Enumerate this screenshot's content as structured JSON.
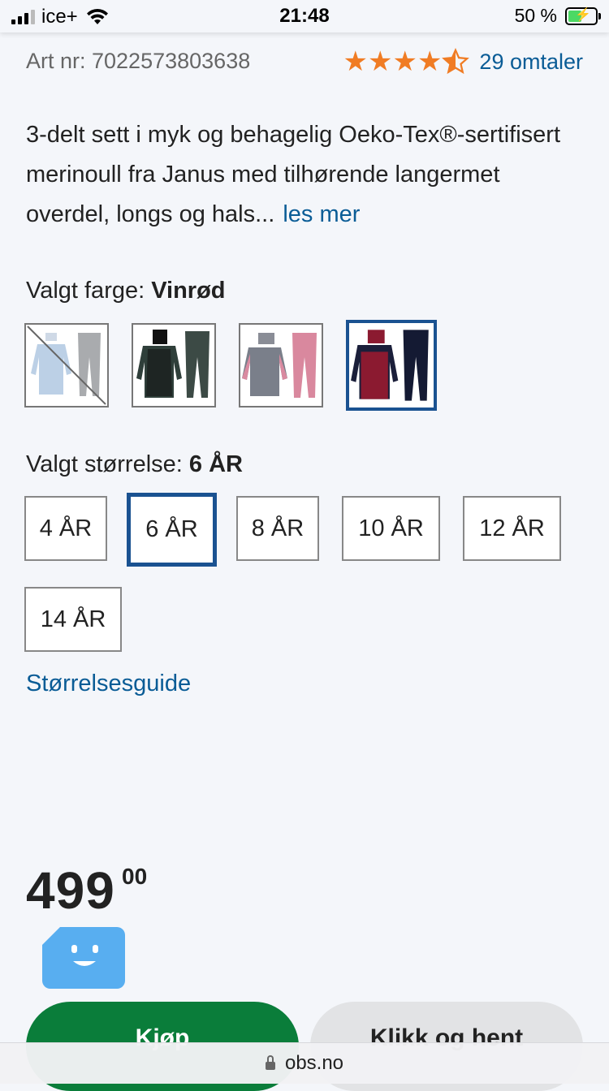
{
  "status_bar": {
    "carrier": "ice+",
    "time": "21:48",
    "battery": "50 %"
  },
  "product": {
    "art_nr": "Art nr: 7022573803638",
    "rating_value": 4.5,
    "reviews": "29 omtaler",
    "description": "3-delt sett i myk og behagelig Oeko-Tex®-sertifisert merinoull fra Janus med tilhørende langermet overdel, longs og hals...",
    "read_more": "les mer",
    "color_label": "Valgt farge: ",
    "color_value": "Vinrød",
    "size_label": "Valgt størrelse: ",
    "size_value": "6 ÅR",
    "sizes": [
      "4 ÅR",
      "6 ÅR",
      "8 ÅR",
      "10 ÅR",
      "12 ÅR",
      "14 ÅR"
    ],
    "size_guide": "Størrelsesguide",
    "price_main": "499",
    "price_decimals": "00"
  },
  "actions": {
    "buy": "Kjøp",
    "click_collect": "Klikk og hent"
  },
  "browser": {
    "url": "obs.no"
  },
  "colors": {
    "accent_blue": "#1a5291",
    "link_blue": "#0a5c96",
    "buy_green": "#0a7d3a",
    "star_orange": "#f07c24",
    "chat_blue": "#58aef0"
  }
}
